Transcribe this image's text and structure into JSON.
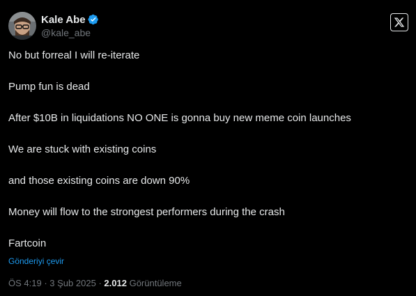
{
  "author": {
    "display_name": "Kale Abe",
    "handle": "@kale_abe",
    "verified_icon": "verified-badge-icon",
    "avatar_icon": "avatar"
  },
  "brand": {
    "logo_icon": "x-logo-icon",
    "logo_glyph": "X"
  },
  "tweet": {
    "lines": [
      "No but forreal I will re-iterate",
      "Pump fun is dead",
      "After $10B in liquidations NO ONE is gonna buy new meme coin launches",
      "We are stuck with existing coins",
      "and those existing coins are down 90%",
      "Money will flow to the strongest performers during the crash",
      "Fartcoin"
    ],
    "translate_label": "Gönderiyi çevir"
  },
  "meta": {
    "time": "ÖS 4:19",
    "separator": "·",
    "date": "3 Şub 2025",
    "views_count": "2.012",
    "views_label": "Görüntüleme"
  },
  "colors": {
    "background": "#000000",
    "text_primary": "#e7e9ea",
    "text_secondary": "#71767b",
    "link": "#1d9bf0",
    "verified": "#1d9bf0"
  }
}
